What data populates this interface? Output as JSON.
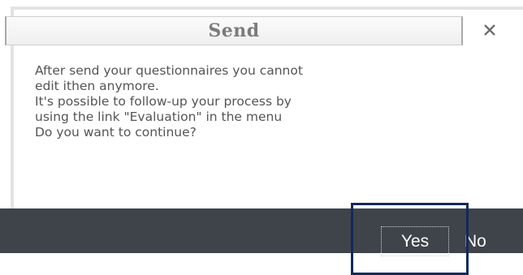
{
  "dialog": {
    "title": "Send",
    "close_icon": "close-icon",
    "message_lines": [
      "After send your questionnaires you cannot",
      "edit ithen anymore.",
      "It's possible to follow-up your process by",
      "using the link \"Evaluation\" in the menu",
      "Do you want to continue?"
    ],
    "buttons": {
      "yes_label": "Yes",
      "no_label": "No"
    }
  },
  "colors": {
    "footer": "#3e4449",
    "highlight_border": "#14295a",
    "title_text": "#7c7c7c",
    "message_text": "#555555"
  }
}
